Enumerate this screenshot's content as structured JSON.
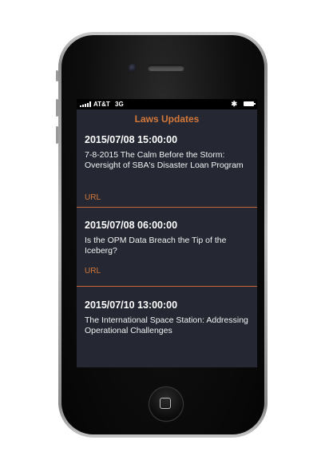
{
  "status_bar": {
    "carrier": "AT&T",
    "network": "3G",
    "bluetooth_icon": "bluetooth-icon",
    "battery_icon": "battery-icon",
    "signal_icon": "signal-bars-icon"
  },
  "app": {
    "title": "Laws Updates",
    "accent_color": "#d4783a",
    "background_color": "#252833"
  },
  "feed": {
    "items": [
      {
        "date": "2015/07/08 15:00:00",
        "title": "7-8-2015 The Calm Before the Storm: Oversight of SBA's Disaster Loan Program",
        "link_label": "URL"
      },
      {
        "date": "2015/07/08 06:00:00",
        "title": "Is the OPM Data Breach the Tip of the Iceberg?",
        "link_label": "URL"
      },
      {
        "date": "2015/07/10 13:00:00",
        "title": "The International Space Station: Addressing Operational Challenges",
        "link_label": ""
      }
    ]
  },
  "device": {
    "home_button_icon": "home-button-icon"
  }
}
